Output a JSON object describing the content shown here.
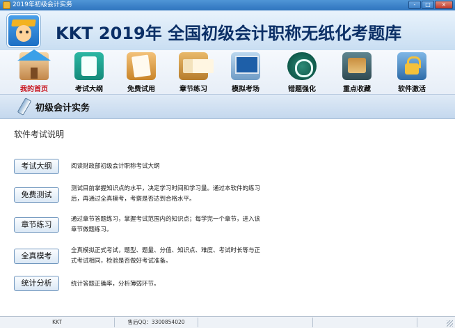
{
  "window": {
    "title": "2019年初级会计实务",
    "controls": [
      "-",
      "□",
      "×"
    ]
  },
  "banner": {
    "title": "KKT 2019年 全国初级会计职称无纸化考题库"
  },
  "toolbar": {
    "items": [
      {
        "label": "我的首页",
        "icon": "home-icon",
        "active": true
      },
      {
        "label": "考试大纲",
        "icon": "outline-book-icon",
        "active": false
      },
      {
        "label": "免费试用",
        "icon": "notepad-pencil-icon",
        "active": false
      },
      {
        "label": "章节练习",
        "icon": "open-book-icon",
        "active": false
      },
      {
        "label": "模拟考场",
        "icon": "monitor-icon",
        "active": false
      },
      {
        "label": "错题强化",
        "icon": "clock-icon",
        "active": false
      },
      {
        "label": "重点收藏",
        "icon": "toolbox-icon",
        "active": false
      },
      {
        "label": "软件激活",
        "icon": "padlock-icon",
        "active": false
      }
    ],
    "active_label_color": "#c8141e"
  },
  "section": {
    "title": "初级会计实务"
  },
  "content": {
    "heading": "软件考试说明",
    "rows": [
      {
        "button": "考试大纲",
        "lines": [
          "阅读财政部初级会计职称考试大纲"
        ]
      },
      {
        "button": "免费测试",
        "lines": [
          "测试目前掌握知识点的水平，决定学习时间和学习量。通过本软件的练习",
          "后，再通过全真模考，考察是否达到合格水平。"
        ]
      },
      {
        "button": "章节练习",
        "lines": [
          "通过章节答题练习，掌握考试范围内的知识点；每学完一个章节，进入该",
          "章节做题练习。"
        ]
      },
      {
        "button": "全真模考",
        "lines": [
          "全真模拟正式考试，题型、题量、分值、知识点、难度、考试时长等与正",
          "式考试相同，检验是否做好考试准备。"
        ]
      },
      {
        "button": "统计分析",
        "lines": [
          "统计答题正确率，分析薄弱环节。"
        ]
      }
    ]
  },
  "statusbar": {
    "left": "KKT",
    "qq": "售后QQ：3300854020",
    "cell3": "",
    "cell4": ""
  }
}
